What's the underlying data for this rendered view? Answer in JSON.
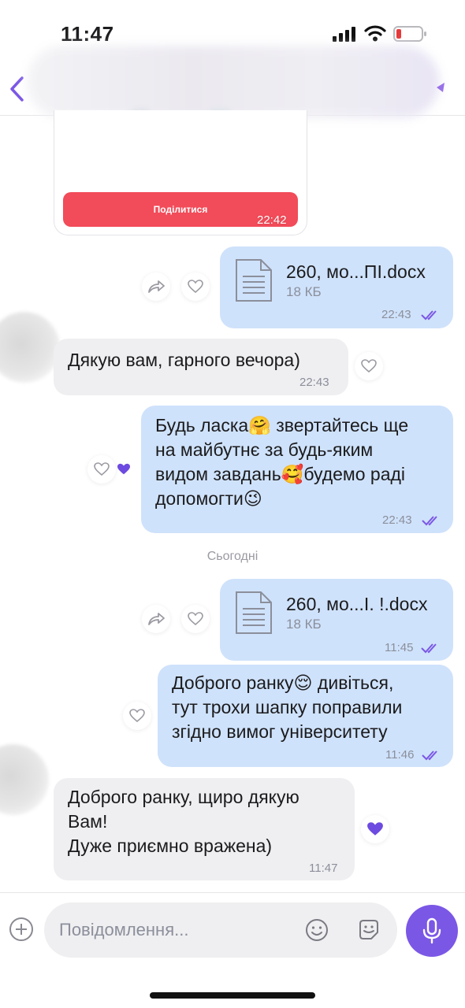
{
  "status_bar": {
    "time": "11:47"
  },
  "card": {
    "share_label": "Поділитися",
    "time": "22:42"
  },
  "messages": {
    "m1": {
      "file_name": "260, мо...ПІ.docx",
      "file_size": "18 КБ",
      "time": "22:43"
    },
    "m2": {
      "text": "Дякую вам, гарного вечора)",
      "time": "22:43"
    },
    "m3": {
      "lines": [
        "Будь ласка🤗 звертайтесь ще",
        "на майбутнє за будь-яким",
        "видом завдань🥰будемо раді",
        "допомогти😉"
      ],
      "time": "22:43"
    },
    "m4": {
      "file_name": "260, мо...І. !.docx",
      "file_size": "18 КБ",
      "time": "11:45"
    },
    "m5": {
      "lines": [
        "Доброго ранку😌 дивіться,",
        "тут трохи шапку поправили",
        "згідно вимог університету"
      ],
      "time": "11:46"
    },
    "m6": {
      "lines": [
        "Доброго ранку, щиро дякую",
        "Вам!",
        "Дуже приємно вражена)"
      ],
      "time": "11:47"
    }
  },
  "day_separator": "Сьогодні",
  "composer": {
    "placeholder": "Повідомлення..."
  },
  "colors": {
    "accent": "#7b57e6",
    "bubble_out": "#cfe2fb",
    "bubble_in": "#efeff1",
    "share_button": "#f24b59"
  },
  "icons": [
    "back-chevron-icon",
    "forward-icon",
    "heart-outline-icon",
    "heart-filled-icon",
    "read-ticks-icon",
    "document-icon",
    "plus-icon",
    "emoji-icon",
    "sticker-icon",
    "microphone-icon"
  ]
}
